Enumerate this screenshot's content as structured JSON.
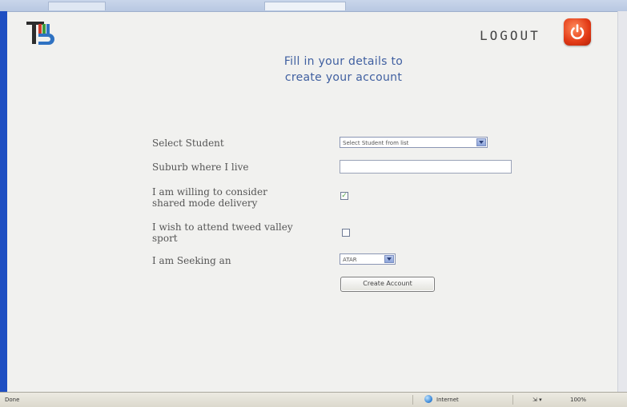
{
  "header": {
    "logo_text": "T5",
    "logout_label": "Logout",
    "heading_line1": "Fill in your details to",
    "heading_line2": "create your account"
  },
  "form": {
    "select_student": {
      "label": "Select Student",
      "value": "Select Student from list"
    },
    "suburb": {
      "label": "Suburb where I live",
      "value": ""
    },
    "shared_mode": {
      "label_line1": "I am willing to consider",
      "label_line2": "shared mode delivery",
      "checked": true
    },
    "tweed_sport": {
      "label_line1": "I wish to attend tweed valley",
      "label_line2": "sport",
      "checked": false
    },
    "seeking": {
      "label": "I am Seeking an",
      "value": "ATAR"
    },
    "create_button": "Create Account"
  },
  "statusbar": {
    "left_text": "Done",
    "zone_text": "Internet",
    "zoom_text": "100%"
  },
  "colors": {
    "heading": "#3f5fa0",
    "logout_button": "#e23a16"
  },
  "icons": {
    "logout": "power-icon",
    "zone": "globe-icon"
  }
}
